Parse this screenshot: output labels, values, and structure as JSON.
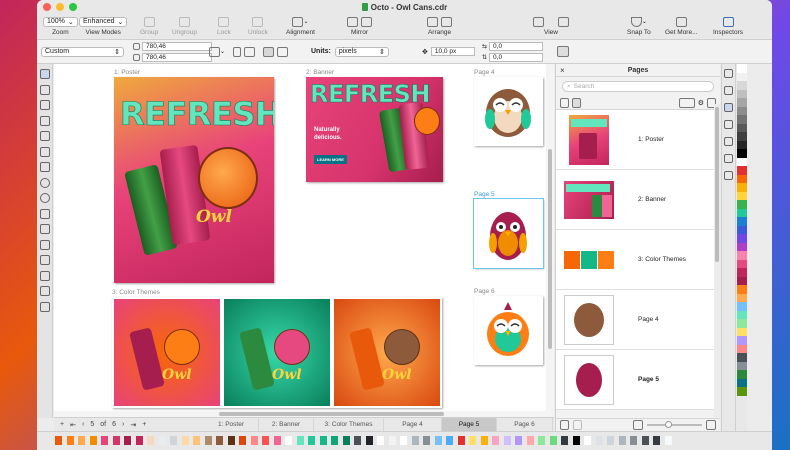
{
  "window": {
    "title": "Octo - Owl Cans.cdr",
    "traffic_lights": [
      "#ff5f57",
      "#febc2e",
      "#28c840"
    ]
  },
  "toolbar": {
    "zoom_value": "100%",
    "zoom_label": "Zoom",
    "view_mode_value": "Enhanced",
    "view_mode_label": "View Modes",
    "group_label": "Group",
    "ungroup_label": "Ungroup",
    "lock_label": "Lock",
    "unlock_label": "Unlock",
    "alignment_label": "Alignment",
    "mirror_label": "Mirror",
    "arrange_label": "Arrange",
    "view_label": "View",
    "snap_label": "Snap To",
    "get_more_label": "Get More...",
    "inspectors_label": "Inspectors"
  },
  "propbar": {
    "preset": "Custom",
    "width": "780,46",
    "height": "780,46",
    "units_label": "Units:",
    "units_value": "pixels",
    "nudge": "10,0 px",
    "dup_x": "0,0",
    "dup_y": "0,0"
  },
  "canvas": {
    "pages": [
      {
        "label": "1: Poster",
        "headline": "REFRESH",
        "brand": "Owl"
      },
      {
        "label": "2: Banner",
        "headline": "REFRESH",
        "tagline_1": "Naturally",
        "tagline_2": "delicious.",
        "button": "LEARN MORE"
      },
      {
        "label": "Page 4"
      },
      {
        "label": "Page 5"
      },
      {
        "label": "Page 6"
      },
      {
        "label": "3: Color Themes",
        "brand": "Owl"
      }
    ]
  },
  "page_nav": {
    "current": "5",
    "of": "of",
    "total": "6",
    "tabs": [
      "1: Poster",
      "2: Banner",
      "3: Color Themes",
      "Page 4",
      "Page 5",
      "Page 6"
    ],
    "active_index": 4
  },
  "pages_docker": {
    "title": "Pages",
    "search_placeholder": "Search",
    "items": [
      "1: Poster",
      "2: Banner",
      "3: Color Themes",
      "Page 4",
      "Page 5"
    ],
    "active_index": 4
  },
  "colors": {
    "accent": "#3a9bdc",
    "poster_bg": "#d6336c",
    "teal": "#0b7285"
  }
}
